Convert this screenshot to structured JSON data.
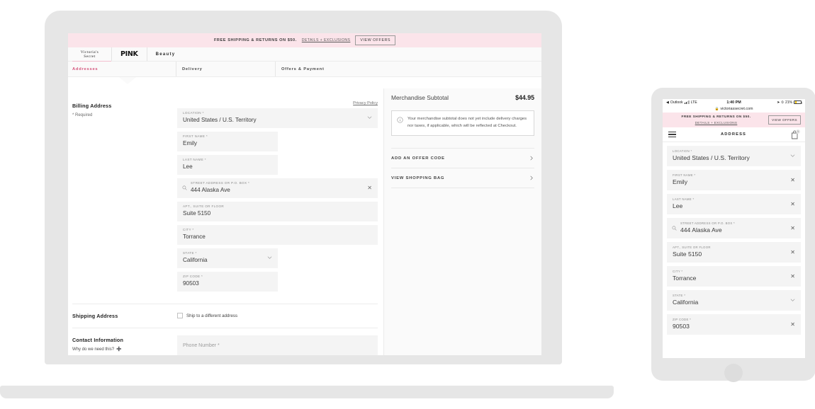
{
  "desktop": {
    "promo": {
      "text": "Free shipping & returns on $50.",
      "link": "Details + Exclusions",
      "button": "View Offers"
    },
    "brand_tabs": [
      {
        "line1": "Victoria's",
        "line2": "Secret",
        "name": "victorias-secret"
      },
      {
        "label": "PINK",
        "name": "pink"
      },
      {
        "label": "Beauty",
        "name": "beauty"
      }
    ],
    "steps": [
      {
        "label": "Addresses",
        "active": true
      },
      {
        "label": "Delivery",
        "active": false
      },
      {
        "label": "Offers & Payment",
        "active": false
      }
    ],
    "billing": {
      "title": "Billing Address",
      "required_note": "* Required",
      "privacy_link": "Privacy Policy",
      "fields": [
        {
          "label": "Location *",
          "value": "United States / U.S. Territory",
          "control": "chevron"
        },
        {
          "label": "First Name *",
          "value": "Emily",
          "control": "none"
        },
        {
          "label": "Last Name *",
          "value": "Lee",
          "control": "none"
        },
        {
          "label": "Street Address or P.O. Box *",
          "value": "444 Alaska Ave",
          "control": "clear",
          "icon": "search-icon"
        },
        {
          "label": "Apt., Suite or Floor",
          "value": "Suite 5150",
          "control": "none"
        },
        {
          "label": "City *",
          "value": "Torrance",
          "control": "none"
        },
        {
          "label": "State *",
          "value": "California",
          "control": "chevron"
        },
        {
          "label": "Zip Code *",
          "value": "90503",
          "control": "none"
        }
      ]
    },
    "shipping": {
      "title": "Shipping Address",
      "checkbox_label": "Ship to a different address",
      "checked": false
    },
    "contact": {
      "title": "Contact Information",
      "why_link": "Why do we need this?",
      "phone_placeholder": "Phone Number *"
    },
    "summary": {
      "subtotal_label": "Merchandise Subtotal",
      "subtotal_amount": "$44.95",
      "note": "Your merchandise subtotal does not yet include delivery charges nor taxes, if applicable, which will be reflected at Checkout.",
      "rows": [
        {
          "label": "Add an Offer Code"
        },
        {
          "label": "View Shopping Bag"
        }
      ]
    }
  },
  "mobile": {
    "status": {
      "back_carrier": "Outlook",
      "network": "LTE",
      "time": "1:40 PM",
      "battery": "21%"
    },
    "url": "victoriassecret.com",
    "promo": {
      "text": "Free shipping & returns on $50.",
      "link": "Details + Exclusions",
      "button": "View Offers"
    },
    "nav": {
      "title": "Address",
      "bag_count": "1"
    },
    "fields": [
      {
        "label": "Location *",
        "value": "United States / U.S. Territory",
        "control": "chevron"
      },
      {
        "label": "First Name *",
        "value": "Emily",
        "control": "clear"
      },
      {
        "label": "Last Name *",
        "value": "Lee",
        "control": "clear"
      },
      {
        "label": "Street Address or P.O. Box *",
        "value": "444 Alaska Ave",
        "control": "clear",
        "icon": "search-icon"
      },
      {
        "label": "Apt., Suite or Floor",
        "value": "Suite 5150",
        "control": "clear"
      },
      {
        "label": "City *",
        "value": "Torrance",
        "control": "clear"
      },
      {
        "label": "State *",
        "value": "California",
        "control": "chevron"
      },
      {
        "label": "Zip Code *",
        "value": "90503",
        "control": "clear"
      }
    ]
  },
  "colors": {
    "accent_pink": "#d4547c",
    "promo_bg": "#fbe4ea",
    "device_frame": "#e6e6e6",
    "field_bg": "#f4f4f4"
  }
}
